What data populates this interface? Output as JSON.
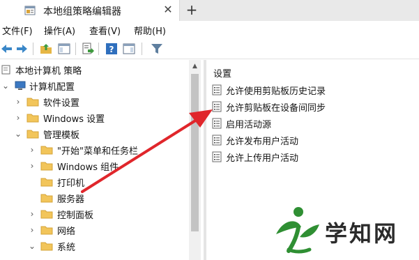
{
  "tab": {
    "title": "本地组策略编辑器",
    "close": "✕",
    "add": "+"
  },
  "menu": [
    {
      "label": "文件(F)"
    },
    {
      "label": "操作(A)"
    },
    {
      "label": "查看(V)"
    },
    {
      "label": "帮助(H)"
    }
  ],
  "tree": {
    "root": "本地计算机 策略",
    "computer_config": "计算机配置",
    "software_settings": "软件设置",
    "windows_settings": "Windows 设置",
    "admin_templates": "管理模板",
    "start_menu": "\"开始\"菜单和任务栏",
    "windows_components": "Windows 组件",
    "printers": "打印机",
    "server": "服务器",
    "control_panel": "控制面板",
    "network": "网络",
    "system": "系统"
  },
  "right": {
    "section_title": "设置",
    "settings": [
      "允许使用剪贴板历史记录",
      "允许剪贴板在设备间同步",
      "启用活动源",
      "允许发布用户活动",
      "允许上传用户活动"
    ]
  },
  "watermark": {
    "text": "学知网"
  },
  "colors": {
    "arrow": "#e0262b",
    "folder": "#f2c55a",
    "watermark_green": "#2f8f33",
    "scroll_thumb": "#c3c3c3"
  }
}
